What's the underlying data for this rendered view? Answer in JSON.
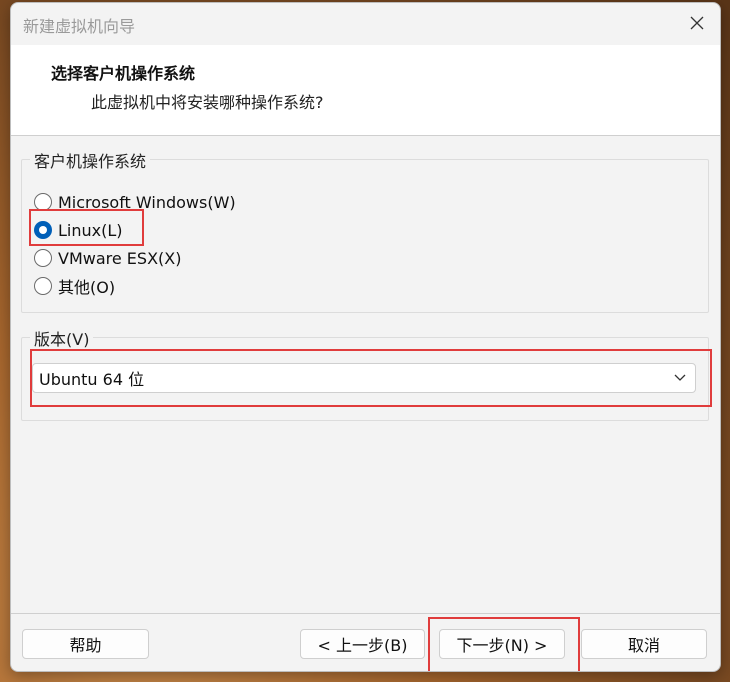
{
  "window": {
    "title": "新建虚拟机向导",
    "close_icon": "close-icon"
  },
  "header": {
    "title": "选择客户机操作系统",
    "subtitle": "此虚拟机中将安装哪种操作系统?"
  },
  "guest_os": {
    "legend": "客户机操作系统",
    "options": [
      {
        "label": "Microsoft Windows(W)",
        "checked": false
      },
      {
        "label": "Linux(L)",
        "checked": true
      },
      {
        "label": "VMware ESX(X)",
        "checked": false
      },
      {
        "label": "其他(O)",
        "checked": false
      }
    ]
  },
  "version": {
    "legend": "版本(V)",
    "selected": "Ubuntu 64 位"
  },
  "buttons": {
    "help": "帮助",
    "back": "< 上一步(B)",
    "next": "下一步(N) >",
    "cancel": "取消"
  },
  "colors": {
    "accent": "#005fb8",
    "highlight": "#e03c3c"
  }
}
